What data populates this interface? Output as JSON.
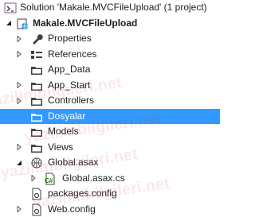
{
  "solution": {
    "label": "Solution 'Makale.MVCFileUpload' (1 project)"
  },
  "project": {
    "label": "Makale.MVCFileUpload"
  },
  "items": [
    {
      "label": "Properties"
    },
    {
      "label": "References"
    },
    {
      "label": "App_Data"
    },
    {
      "label": "App_Start"
    },
    {
      "label": "Controllers"
    },
    {
      "label": "Dosyalar"
    },
    {
      "label": "Models"
    },
    {
      "label": "Views"
    },
    {
      "label": "Global.asax"
    },
    {
      "label": "Global.asax.cs"
    },
    {
      "label": "packages.config"
    },
    {
      "label": "Web.config"
    }
  ],
  "watermark": {
    "text": "yazilimbilgileri.net"
  },
  "colors": {
    "selection": "#3399ff",
    "folder": "#dcb67a",
    "csharp": "#178600"
  },
  "selected_item": "Dosyalar"
}
